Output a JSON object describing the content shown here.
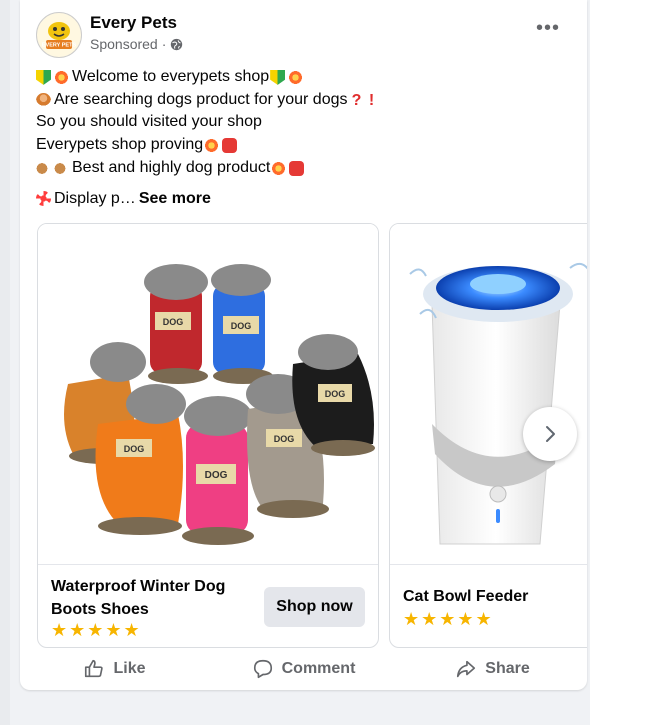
{
  "post": {
    "page_name": "Every Pets",
    "sponsored_label": "Sponsored",
    "separator": "·",
    "avatar_text": "EVERY PETS"
  },
  "caption": {
    "line1": "Welcome to everypets shop",
    "line2": "Are searching dogs product for your dogs",
    "line3": "So you should visited your shop",
    "line4": "Everypets shop proving",
    "line5": "Best and highly dog product",
    "line6": "Display p…",
    "see_more": "See more"
  },
  "carousel": [
    {
      "title": "Waterproof Winter Dog Boots Shoes",
      "stars": "★★★★★",
      "button_label": "Shop now",
      "image_label": "DOG"
    },
    {
      "title": "Cat Bowl Feeder",
      "stars": "★★★★★"
    }
  ],
  "actions": {
    "like": "Like",
    "comment": "Comment",
    "share": "Share"
  },
  "icons": {
    "more": "more-options-icon",
    "globe": "globe-icon",
    "next": "chevron-right-icon",
    "like": "thumbs-up-icon",
    "comment": "comment-icon",
    "share": "share-icon"
  },
  "colors": {
    "meta_text": "#65676b",
    "button_bg": "#e4e6eb",
    "star": "#f7b500",
    "background": "#f0f2f5"
  }
}
